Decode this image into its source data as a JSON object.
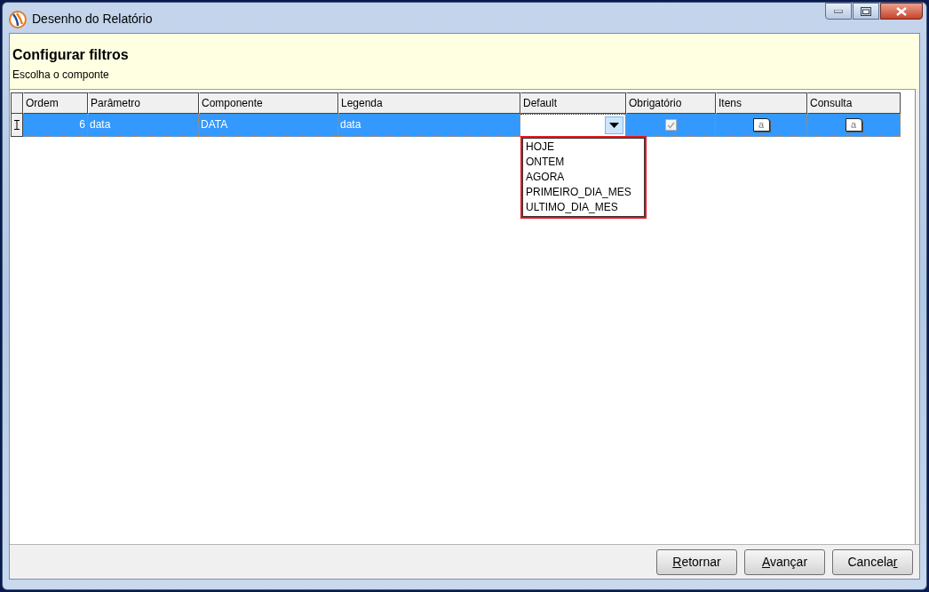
{
  "window": {
    "title": "Desenho do Relatório"
  },
  "header": {
    "title": "Configurar filtros",
    "subtitle": "Escolha o componte"
  },
  "grid": {
    "columns": [
      "Ordem",
      "Parâmetro",
      "Componente",
      "Legenda",
      "Default",
      "Obrigatório",
      "Itens",
      "Consulta"
    ],
    "rows": [
      {
        "selected": true,
        "editing": true,
        "ordem": "6",
        "parametro": "data",
        "componente": "DATA",
        "legenda": "data",
        "default": {
          "expanded": true,
          "highlighted": true,
          "options": [
            "HOJE",
            "ONTEM",
            "AGORA",
            "PRIMEIRO_DIA_MES",
            "ULTIMO_DIA_MES"
          ]
        },
        "obrigatorio": {
          "checked": true,
          "disabled": true
        },
        "itens": "a",
        "consulta": "a"
      }
    ]
  },
  "buttons": [
    {
      "key": "R",
      "after": "etornar"
    },
    {
      "key": "A",
      "after": "vançar"
    },
    {
      "before": "Cancela",
      "key": "r"
    }
  ]
}
